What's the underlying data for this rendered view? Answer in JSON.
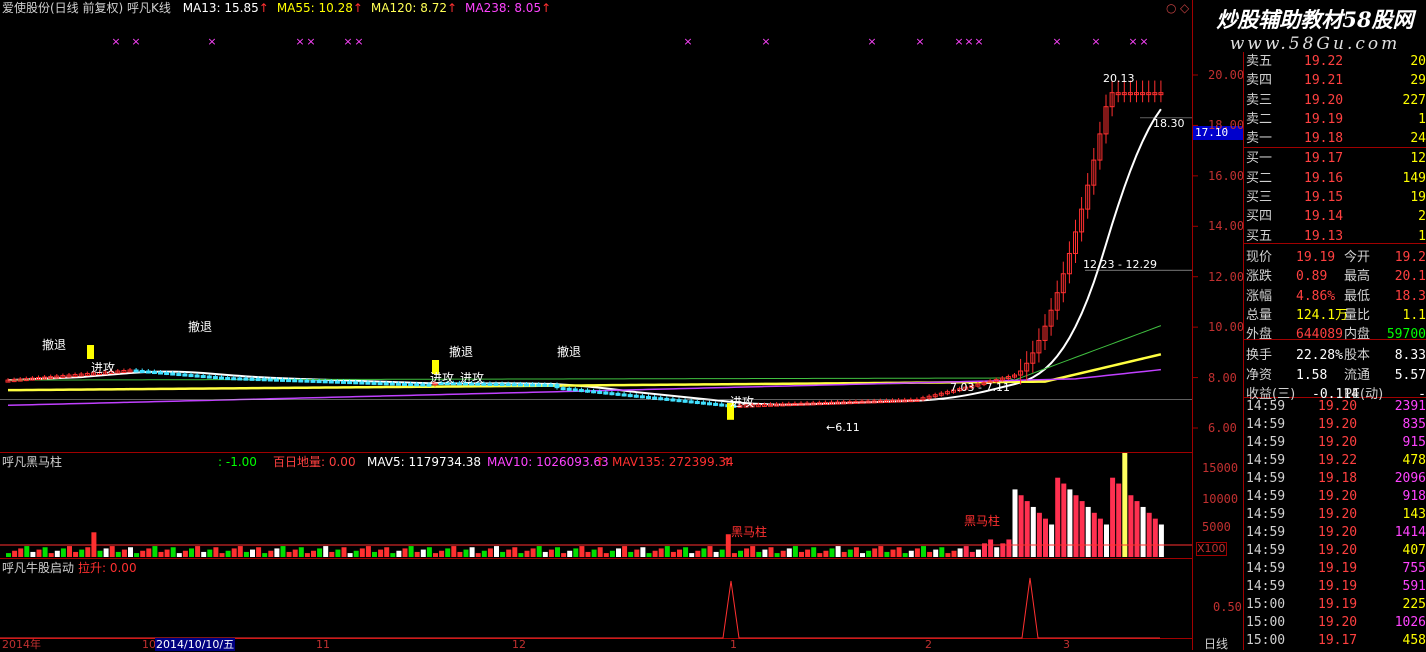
{
  "window": {
    "title_line": "爱使股份(日线 前复权) 呼凡K线",
    "ma_legend": [
      {
        "label": "MA13: 15.85",
        "color": "#ffffff"
      },
      {
        "label": "MA55: 10.28",
        "color": "#ffff00"
      },
      {
        "label": "MA120: 8.72",
        "color": "#ffff55"
      },
      {
        "label": "MA238: 8.05",
        "color": "#ff44ff"
      }
    ],
    "arrow_glyph": "↑",
    "close_glyph": "○",
    "expand_glyph": "◇"
  },
  "watermark": {
    "line1": "炒股辅助教材58股网",
    "line2": "www.58Gu.com"
  },
  "price_axis": [
    "20.00",
    "18.00",
    "16.00",
    "14.00",
    "12.00",
    "10.00",
    "8.00",
    "6.00"
  ],
  "price_marker": "17.10",
  "annotations": {
    "high_label": "20.13",
    "last_label": "18.30",
    "range_label_1": "12.23 - 12.29",
    "range_label_2": "7.03 - 7.11",
    "low_label": "←6.11",
    "retreat": "撤退",
    "attack": "进攻",
    "black_horse": "黑马柱"
  },
  "volume_panel": {
    "title": "呼凡黑马柱",
    "value1": ": -1.00",
    "label2": "百日地量: 0.00",
    "mav5": "MAV5: 1179734.38",
    "mav10": "MAV10: 1026093.63",
    "mav135": "MAV135: 272399.34",
    "axis": [
      "15000",
      "10000",
      "5000"
    ],
    "unit": "X100"
  },
  "bull_panel": {
    "title": "呼凡牛股启动",
    "value": "拉升: 0.00",
    "axis": "0.50"
  },
  "date_axis": [
    "2014年",
    "10",
    "2014/10/10/五",
    "11",
    "12",
    "1",
    "2",
    "3"
  ],
  "period_label": "日线",
  "order_book": [
    {
      "label": "卖五",
      "price": "19.22",
      "vol": "20",
      "vc": "#ffff00"
    },
    {
      "label": "卖四",
      "price": "19.21",
      "vol": "29",
      "vc": "#ffff00"
    },
    {
      "label": "卖三",
      "price": "19.20",
      "vol": "227",
      "vc": "#ffff00"
    },
    {
      "label": "卖二",
      "price": "19.19",
      "vol": "1",
      "vc": "#ffff00"
    },
    {
      "label": "卖一",
      "price": "19.18",
      "vol": "24",
      "vc": "#ffff00"
    },
    {
      "label": "买一",
      "price": "19.17",
      "vol": "12",
      "vc": "#ffff00"
    },
    {
      "label": "买二",
      "price": "19.16",
      "vol": "149",
      "vc": "#ffff00"
    },
    {
      "label": "买三",
      "price": "19.15",
      "vol": "19",
      "vc": "#ffff00"
    },
    {
      "label": "买四",
      "price": "19.14",
      "vol": "2",
      "vc": "#ffff00"
    },
    {
      "label": "买五",
      "price": "19.13",
      "vol": "1",
      "vc": "#ffff00"
    }
  ],
  "stats": [
    {
      "k1": "现价",
      "v1": "19.19",
      "c1": "#ff4040",
      "k2": "今开",
      "v2": "19.2",
      "c2": "#ff4040"
    },
    {
      "k1": "涨跌",
      "v1": "0.89",
      "c1": "#ff4040",
      "k2": "最高",
      "v2": "20.1",
      "c2": "#ff4040"
    },
    {
      "k1": "涨幅",
      "v1": "4.86%",
      "c1": "#ff4040",
      "k2": "最低",
      "v2": "18.3",
      "c2": "#ff4040"
    },
    {
      "k1": "总量",
      "v1": "124.1万",
      "c1": "#ffff00",
      "k2": "量比",
      "v2": "1.1",
      "c2": "#ffff00"
    },
    {
      "k1": "外盘",
      "v1": "644089",
      "c1": "#ff4040",
      "k2": "内盘",
      "v2": "59700",
      "c2": "#00ff00"
    },
    {
      "k1": "换手",
      "v1": "22.28%",
      "c1": "#ffffff",
      "k2": "股本",
      "v2": "8.33",
      "c2": "#ffffff"
    },
    {
      "k1": "净资",
      "v1": "1.58",
      "c1": "#ffffff",
      "k2": "流通",
      "v2": "5.57",
      "c2": "#ffffff"
    },
    {
      "k1": "收益(三)",
      "v1": "-0.114",
      "c1": "#ffffff",
      "k2": "PE(动)",
      "v2": "-",
      "c2": "#ffffff"
    }
  ],
  "trades": [
    {
      "time": "14:59",
      "price": "19.20",
      "vol": "2391",
      "vc": "#ff44ff"
    },
    {
      "time": "14:59",
      "price": "19.20",
      "vol": "835",
      "vc": "#ff44ff"
    },
    {
      "time": "14:59",
      "price": "19.20",
      "vol": "915",
      "vc": "#ff44ff"
    },
    {
      "time": "14:59",
      "price": "19.22",
      "vol": "478",
      "vc": "#ffff00"
    },
    {
      "time": "14:59",
      "price": "19.18",
      "vol": "2096",
      "vc": "#ff44ff"
    },
    {
      "time": "14:59",
      "price": "19.20",
      "vol": "918",
      "vc": "#ff44ff"
    },
    {
      "time": "14:59",
      "price": "19.20",
      "vol": "143",
      "vc": "#ffff00"
    },
    {
      "time": "14:59",
      "price": "19.20",
      "vol": "1414",
      "vc": "#ff44ff"
    },
    {
      "time": "14:59",
      "price": "19.20",
      "vol": "407",
      "vc": "#ffff00"
    },
    {
      "time": "14:59",
      "price": "19.19",
      "vol": "755",
      "vc": "#ff44ff"
    },
    {
      "time": "14:59",
      "price": "19.19",
      "vol": "591",
      "vc": "#ff44ff"
    },
    {
      "time": "15:00",
      "price": "19.19",
      "vol": "225",
      "vc": "#ffff00"
    },
    {
      "time": "15:00",
      "price": "19.20",
      "vol": "1026",
      "vc": "#ff44ff"
    },
    {
      "time": "15:00",
      "price": "19.17",
      "vol": "458",
      "vc": "#ffff00"
    }
  ]
}
